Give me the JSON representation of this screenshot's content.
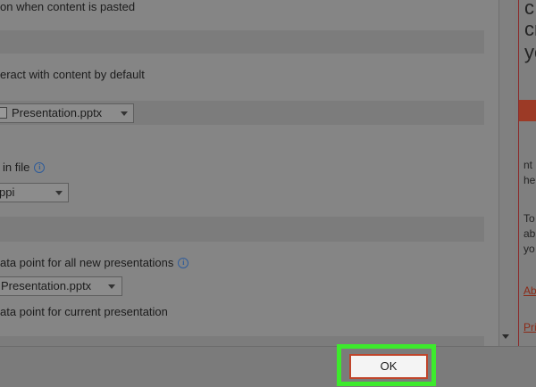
{
  "options": {
    "paste_text": "on when content is pasted",
    "interact_text": "eract with content by default",
    "interact_dropdown": "Presentation.pptx",
    "image_size_label": "in file",
    "image_resolution_value": "ppi",
    "data_point_all_label": "ata point for all new presentations",
    "data_point_all_dropdown": "Presentation.pptx",
    "data_point_current_label": "ata point for current presentation"
  },
  "right_panel": {
    "chars_large": [
      "c",
      "cr",
      "yo"
    ],
    "chars_small": [
      "nt",
      "hel",
      "To",
      "abl",
      "yo"
    ],
    "links": [
      "Ab",
      "Pri"
    ]
  },
  "footer": {
    "ok_label": "OK"
  },
  "colors": {
    "highlight": "#3dea2c",
    "ok_border": "#c0452b"
  }
}
